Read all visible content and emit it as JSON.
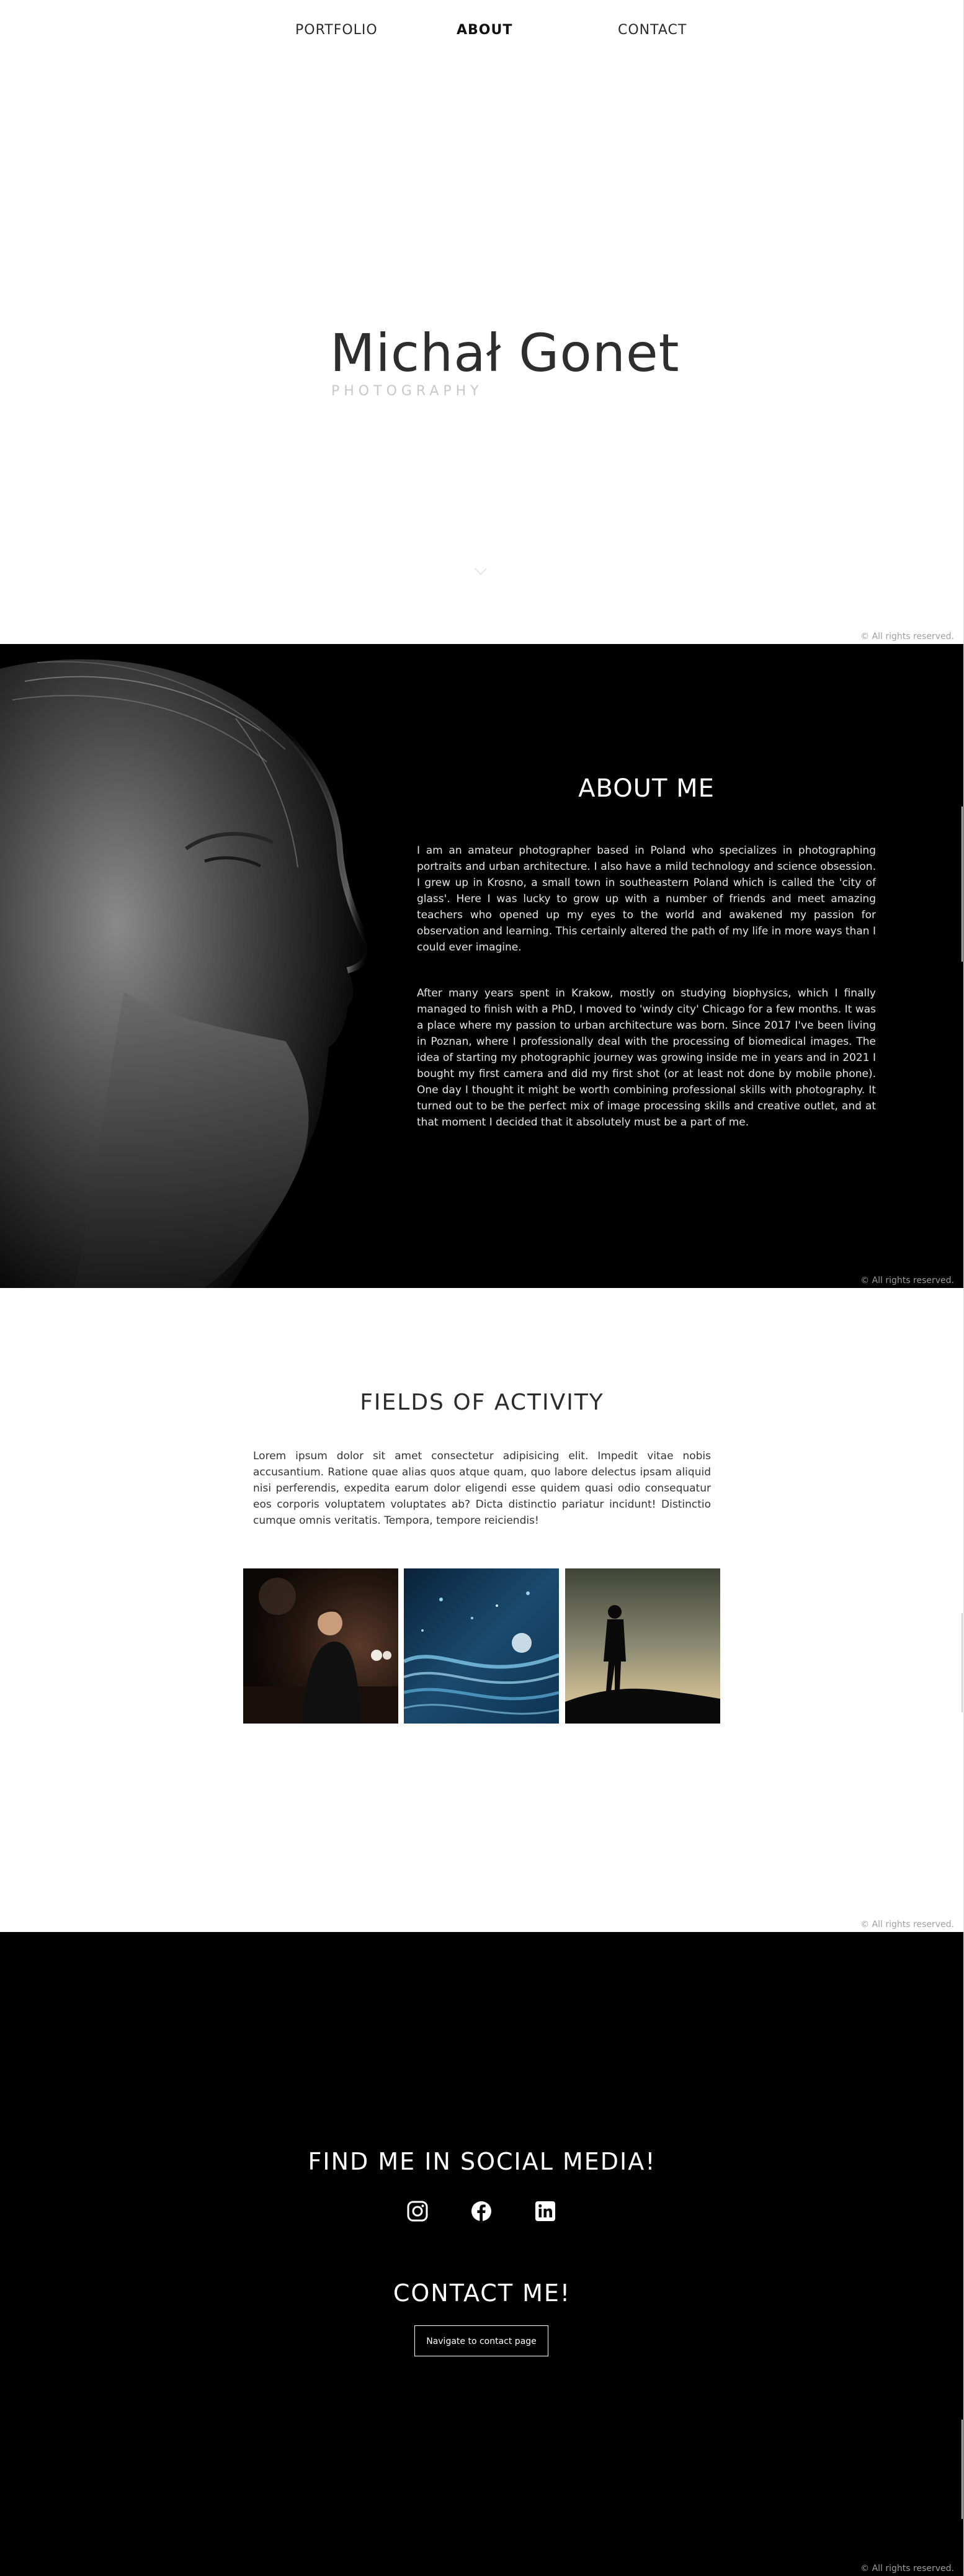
{
  "nav": {
    "portfolio": "PORTFOLIO",
    "about": "ABOUT",
    "contact": "CONTACT",
    "active": "ABOUT"
  },
  "hero": {
    "title": "Michał Gonet",
    "subtitle": "PHOTOGRAPHY"
  },
  "footer": {
    "copyright": "© All rights reserved."
  },
  "about": {
    "heading": "ABOUT ME",
    "paragraph_1": "I am an amateur photographer based in Poland who specializes in photographing portraits and urban architecture. I also have a mild technology and science obsession. I grew up in Krosno, a small town in southeastern Poland which is called the 'city of glass'. Here I was lucky to grow up with a number of friends and meet amazing teachers who opened up my eyes to the world and awakened my passion for observation and learning. This certainly altered the path of my life in more ways than I could ever imagine.",
    "paragraph_2": "After many years spent in Krakow, mostly on studying biophysics, which I finally managed to finish with a PhD, I moved to 'windy city' Chicago for a few months. It was a place where my passion to urban architecture was born. Since 2017 I've been living in Poznan, where I professionally deal with the processing of biomedical images. The idea of starting my photographic journey was growing inside me in years and in 2021 I bought my first camera and did my first shot (or at least not done by mobile phone). One day I thought it might be worth combining professional skills with photography. It turned out to be the perfect mix of image processing skills and creative outlet, and at that moment I decided that it absolutely must be a part of me.",
    "portrait_icon": "bearded-man-profile-portrait"
  },
  "fields": {
    "heading": "FIELDS OF ACTIVITY",
    "text": "Lorem ipsum dolor sit amet consectetur adipisicing elit. Impedit vitae nobis accusantium. Ratione quae alias quos atque quam, quo labore delectus ipsam aliquid nisi perferendis, expedita earum dolor eligendi esse quidem quasi odio consequatur eos corporis voluptatem voluptates ab? Dicta distinctio pariatur incidunt! Distinctio cumque omnis veritatis. Tempora, tempore reiciendis!",
    "images": [
      {
        "icon": "portrait-photo-man-in-bar"
      },
      {
        "icon": "abstract-blue-macro-photo"
      },
      {
        "icon": "silhouette-at-dusk-photo"
      }
    ]
  },
  "social": {
    "heading": "FIND ME IN SOCIAL MEDIA!",
    "icons": [
      "instagram-icon",
      "facebook-icon",
      "linkedin-icon"
    ]
  },
  "contact": {
    "heading": "CONTACT ME!",
    "button_label": "Navigate to contact page"
  },
  "colors": {
    "dark_bg": "#000000",
    "light_bg": "#ffffff",
    "text_dark": "#2b2b2b",
    "subtitle_grey": "#c8c8c8",
    "copyright_grey": "#a0a0a0"
  }
}
